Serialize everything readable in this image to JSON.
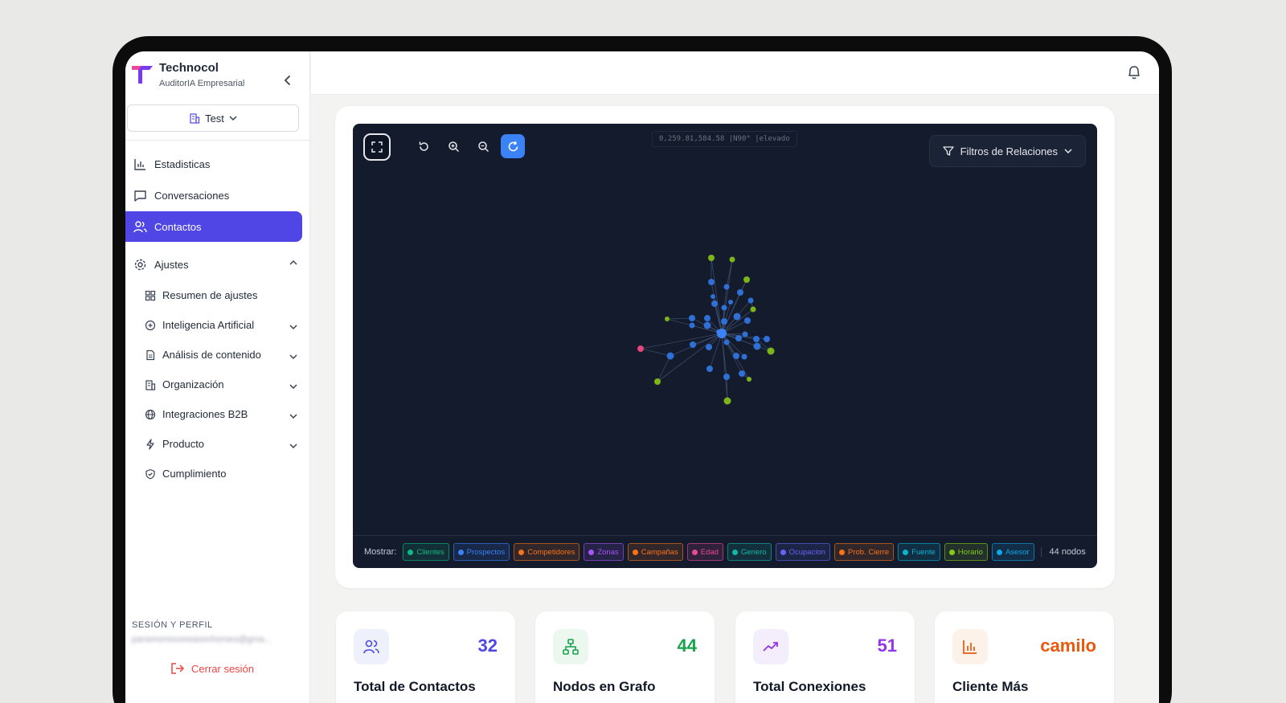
{
  "brand": {
    "name": "Technocol",
    "subtitle": "AuditorIA Empresarial"
  },
  "workspace": {
    "label": "Test"
  },
  "nav": {
    "stats": "Estadisticas",
    "conversations": "Conversaciones",
    "contacts": "Contactos",
    "settings": "Ajustes",
    "sub": [
      {
        "label": "Resumen de ajustes",
        "icon": "grid-icon",
        "expandable": false
      },
      {
        "label": "Inteligencia Artificial",
        "icon": "ai-icon",
        "expandable": true
      },
      {
        "label": "Análisis de contenido",
        "icon": "document-icon",
        "expandable": true
      },
      {
        "label": "Organización",
        "icon": "building-icon",
        "expandable": true
      },
      {
        "label": "Integraciones B2B",
        "icon": "globe-icon",
        "expandable": true
      },
      {
        "label": "Producto",
        "icon": "bolt-icon",
        "expandable": true
      },
      {
        "label": "Cumplimiento",
        "icon": "shield-icon",
        "expandable": false
      }
    ]
  },
  "session": {
    "title": "SESIÓN Y PERFIL",
    "email": "parsimoniousreasonhorses@gma...",
    "logout": "Cerrar sesión"
  },
  "graph": {
    "coords": "0,259.81,584.58 |N90° |elevado",
    "filters_label": "Filtros de Relaciones",
    "show_label": "Mostrar:",
    "chips": [
      {
        "label": "Clientes",
        "color": "#10b981"
      },
      {
        "label": "Prospectos",
        "color": "#3b82f6"
      },
      {
        "label": "Competidores",
        "color": "#f97316"
      },
      {
        "label": "Zonas",
        "color": "#a855f7"
      },
      {
        "label": "Campañas",
        "color": "#f97316"
      },
      {
        "label": "Edad",
        "color": "#ec4899"
      },
      {
        "label": "Genero",
        "color": "#14b8a6"
      },
      {
        "label": "Ocupacion",
        "color": "#6366f1"
      },
      {
        "label": "Prob. Cierre",
        "color": "#f97316"
      },
      {
        "label": "Fuente",
        "color": "#06b6d4"
      },
      {
        "label": "Horario",
        "color": "#84cc16"
      },
      {
        "label": "Asesor",
        "color": "#0ea5e9"
      }
    ],
    "node_count": "44 nodos"
  },
  "stats": [
    {
      "value": "32",
      "label": "Total de Contactos",
      "color": "#4f46e5",
      "bg": "#eef0fb",
      "icon": "users-icon"
    },
    {
      "value": "44",
      "label": "Nodos en Grafo",
      "color": "#16a34a",
      "bg": "#ecf7ef",
      "icon": "network-icon"
    },
    {
      "value": "51",
      "label": "Total Conexiones",
      "color": "#9333ea",
      "bg": "#f4eefc",
      "icon": "trending-icon"
    },
    {
      "value": "camilo",
      "label": "Cliente Más",
      "color": "#ea580c",
      "bg": "#fdf2ea",
      "icon": "bar-chart-icon"
    }
  ]
}
